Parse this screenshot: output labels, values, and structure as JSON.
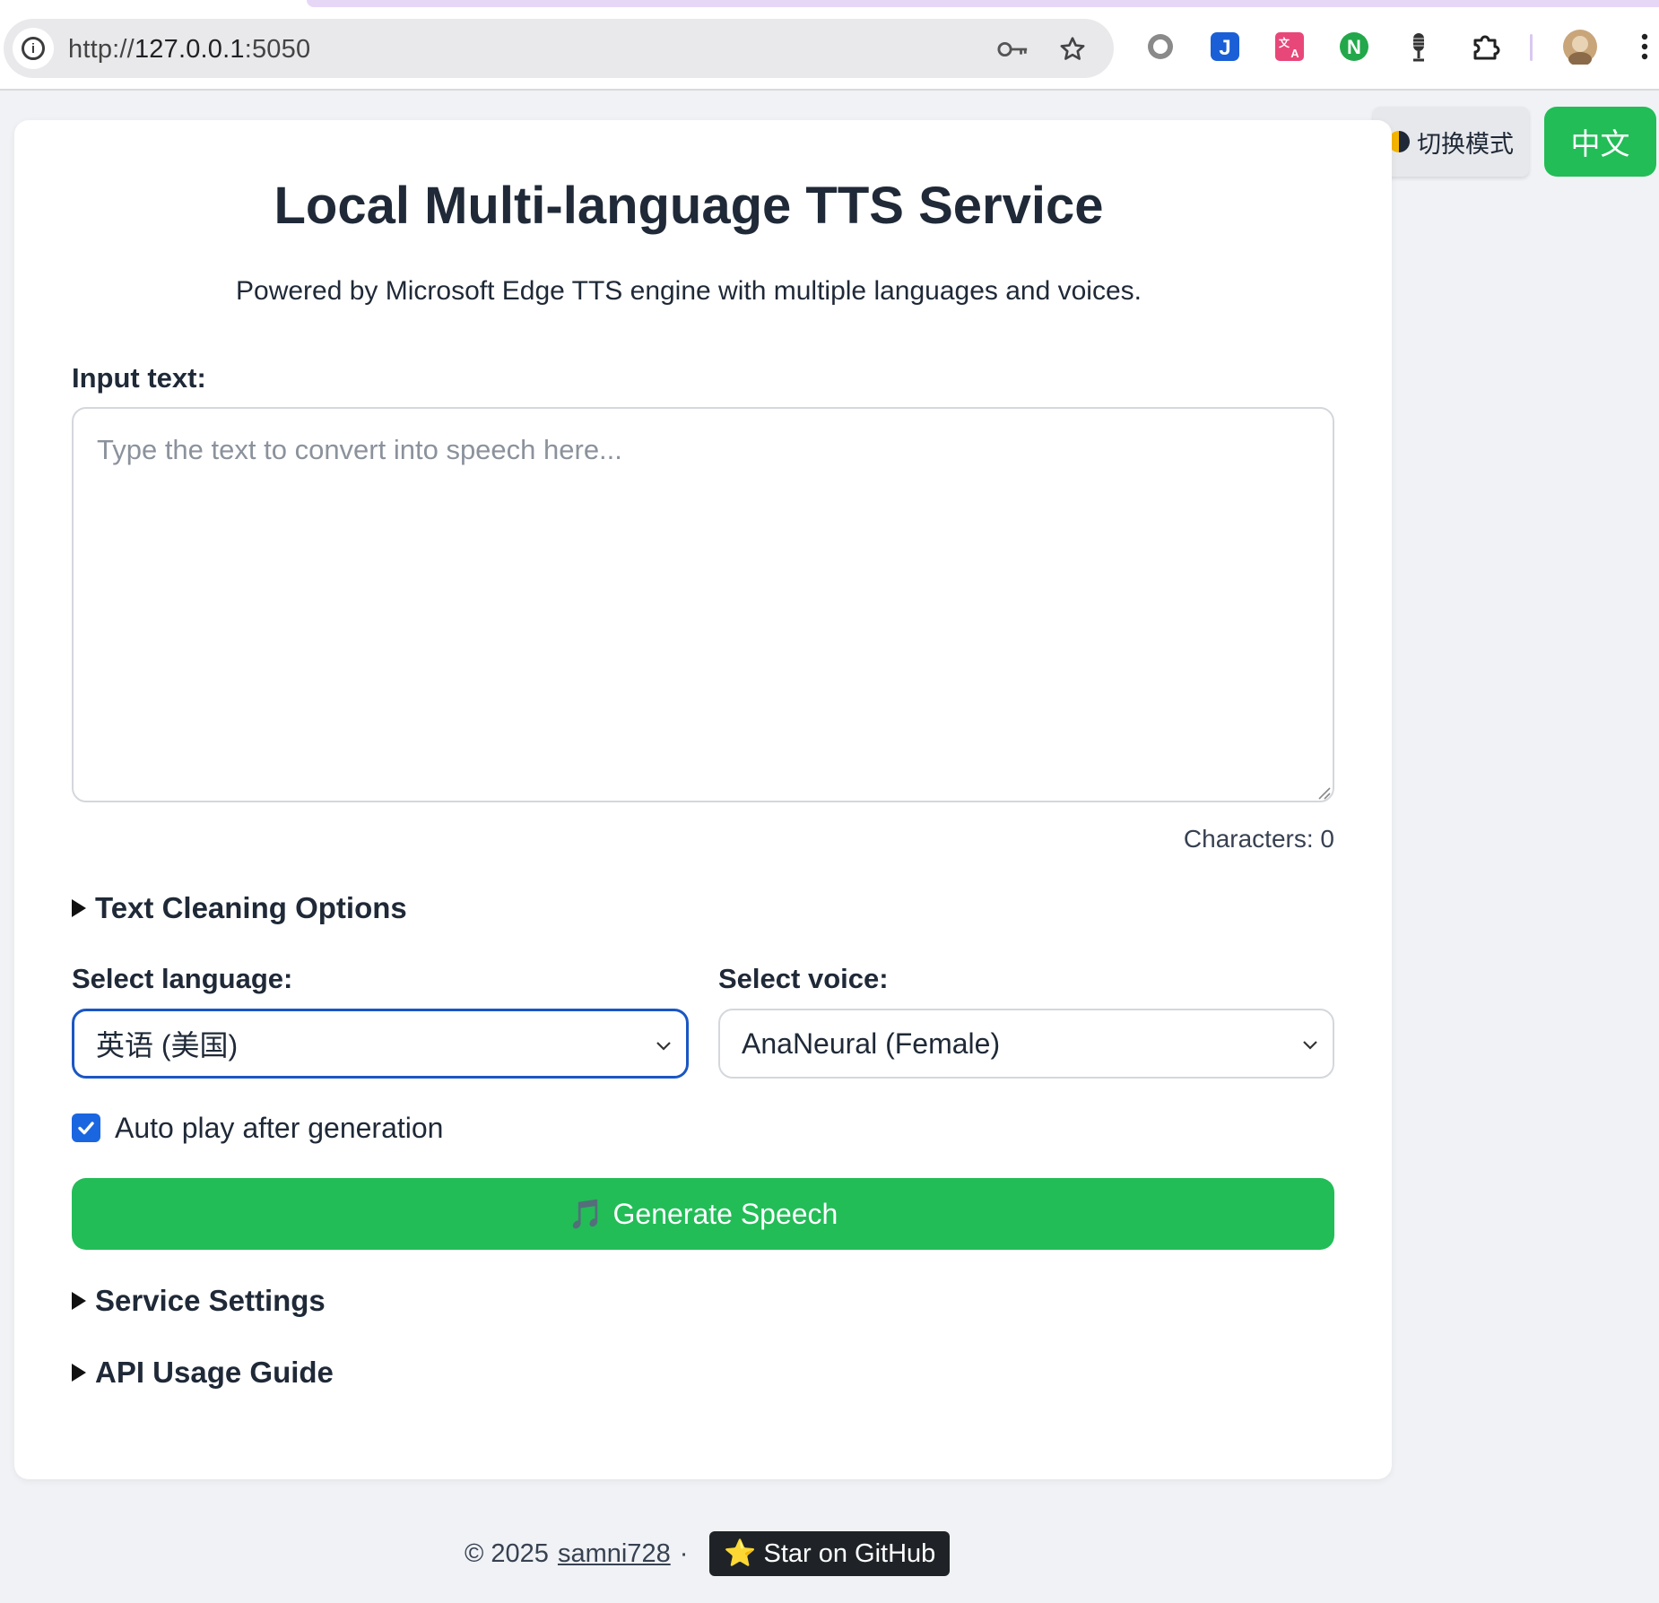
{
  "browser": {
    "url_scheme": "http://",
    "url_host": "127.0.0.1",
    "url_port": ":5050",
    "extensions": [
      "record-icon",
      "j-extension-icon",
      "translate-icon",
      "n-extension-icon",
      "microphone-icon",
      "puzzle-icon"
    ]
  },
  "toolbar": {
    "mode_toggle_label": "切换模式",
    "language_toggle_label": "中文",
    "accent_color": "#22bd57"
  },
  "main": {
    "title": "Local Multi-language TTS Service",
    "subtitle": "Powered by Microsoft Edge TTS engine with multiple languages and voices.",
    "input_label": "Input text:",
    "input_placeholder": "Type the text to convert into speech here...",
    "input_value": "",
    "char_count": "Characters: 0",
    "text_cleaning_label": "Text Cleaning Options",
    "language_label": "Select language:",
    "language_value": "英语 (美国)",
    "voice_label": "Select voice:",
    "voice_value": "AnaNeural (Female)",
    "autoplay_label": "Auto play after generation",
    "autoplay_checked": true,
    "generate_icon": "🎵",
    "generate_label": "Generate Speech",
    "service_settings_label": "Service Settings",
    "api_guide_label": "API Usage Guide"
  },
  "footer": {
    "copyright": "© 2025",
    "author": "samni728",
    "separator": "·",
    "star_icon": "⭐",
    "star_label": "Star on GitHub"
  }
}
